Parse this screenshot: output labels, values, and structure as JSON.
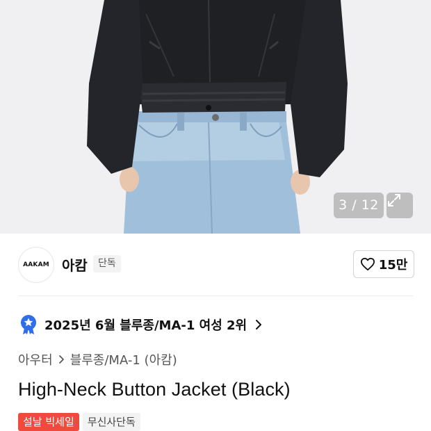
{
  "gallery": {
    "counter": "3 / 12"
  },
  "brand": {
    "logo_text": "AAKAM",
    "name": "아캄",
    "tag": "단독"
  },
  "like": {
    "count": "15만"
  },
  "ranking": {
    "text": "2025년 6월 블루종/MA-1 여성 2위"
  },
  "breadcrumb": {
    "items": [
      "아우터",
      "블루종/MA-1 (아캄)"
    ]
  },
  "product": {
    "title": "High-Neck Button Jacket (Black)"
  },
  "badges": {
    "sale": "설날 빅세일",
    "exclusive": "무신사단독"
  },
  "colors": {
    "sale_badge": "#ee4b3c",
    "rank_icon": "#2f6ee8"
  }
}
